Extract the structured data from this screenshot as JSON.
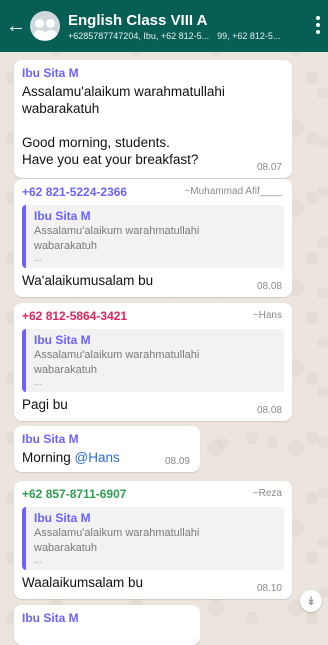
{
  "header": {
    "title": "English Class VIII A",
    "subtitle_left": "+6285787747204, Ibu, +62 812-5...",
    "subtitle_right": "99, +62 812-5..."
  },
  "messages": [
    {
      "sender": "Ibu Sita M",
      "sender_color": "#6c63ff",
      "text_line1": "Assalamu'alaikum warahmatullahi",
      "text_line2": "wabarakatuh",
      "text_line3": "Good morning, students.",
      "text_line4": "Have you eat your breakfast?",
      "time": "08.07"
    },
    {
      "sender": "+62 821-5224-2366",
      "sender_color": "#6c63ff",
      "alias": "~Muhammad Afif____",
      "quote_name": "Ibu Sita M",
      "quote_line1": "Assalamu'alaikum warahmatullahi",
      "quote_line2": "wabarakatuh",
      "quote_dots": "...",
      "text": "Wa'alaikumusalam bu",
      "time": "08.08"
    },
    {
      "sender": "+62 812-5864-3421",
      "sender_color": "#e0245e",
      "alias": "~Hans",
      "quote_name": "Ibu Sita M",
      "quote_line1": "Assalamu'alaikum warahmatullahi",
      "quote_line2": "wabarakatuh",
      "quote_dots": "...",
      "text": "Pagi bu",
      "time": "08.08"
    },
    {
      "sender": "Ibu Sita M",
      "sender_color": "#6c63ff",
      "text": "Morning",
      "mention": "@Hans",
      "time": "08.09"
    },
    {
      "sender": "+62 857-8711-6907",
      "sender_color": "#2e9e4f",
      "alias": "~Reza",
      "quote_name": "Ibu Sita M",
      "quote_line1": "Assalamu'alaikum warahmatullahi",
      "quote_line2": "wabarakatuh",
      "quote_dots": "...",
      "text": "Waalaikumsalam bu",
      "time": "08.10"
    },
    {
      "sender": "Ibu Sita M",
      "sender_color": "#6c63ff"
    }
  ],
  "icons": {
    "back": "arrow-left-icon",
    "avatar": "group-avatar-icon",
    "menu": "more-vert-icon",
    "scroll": "chevron-double-down-icon"
  }
}
